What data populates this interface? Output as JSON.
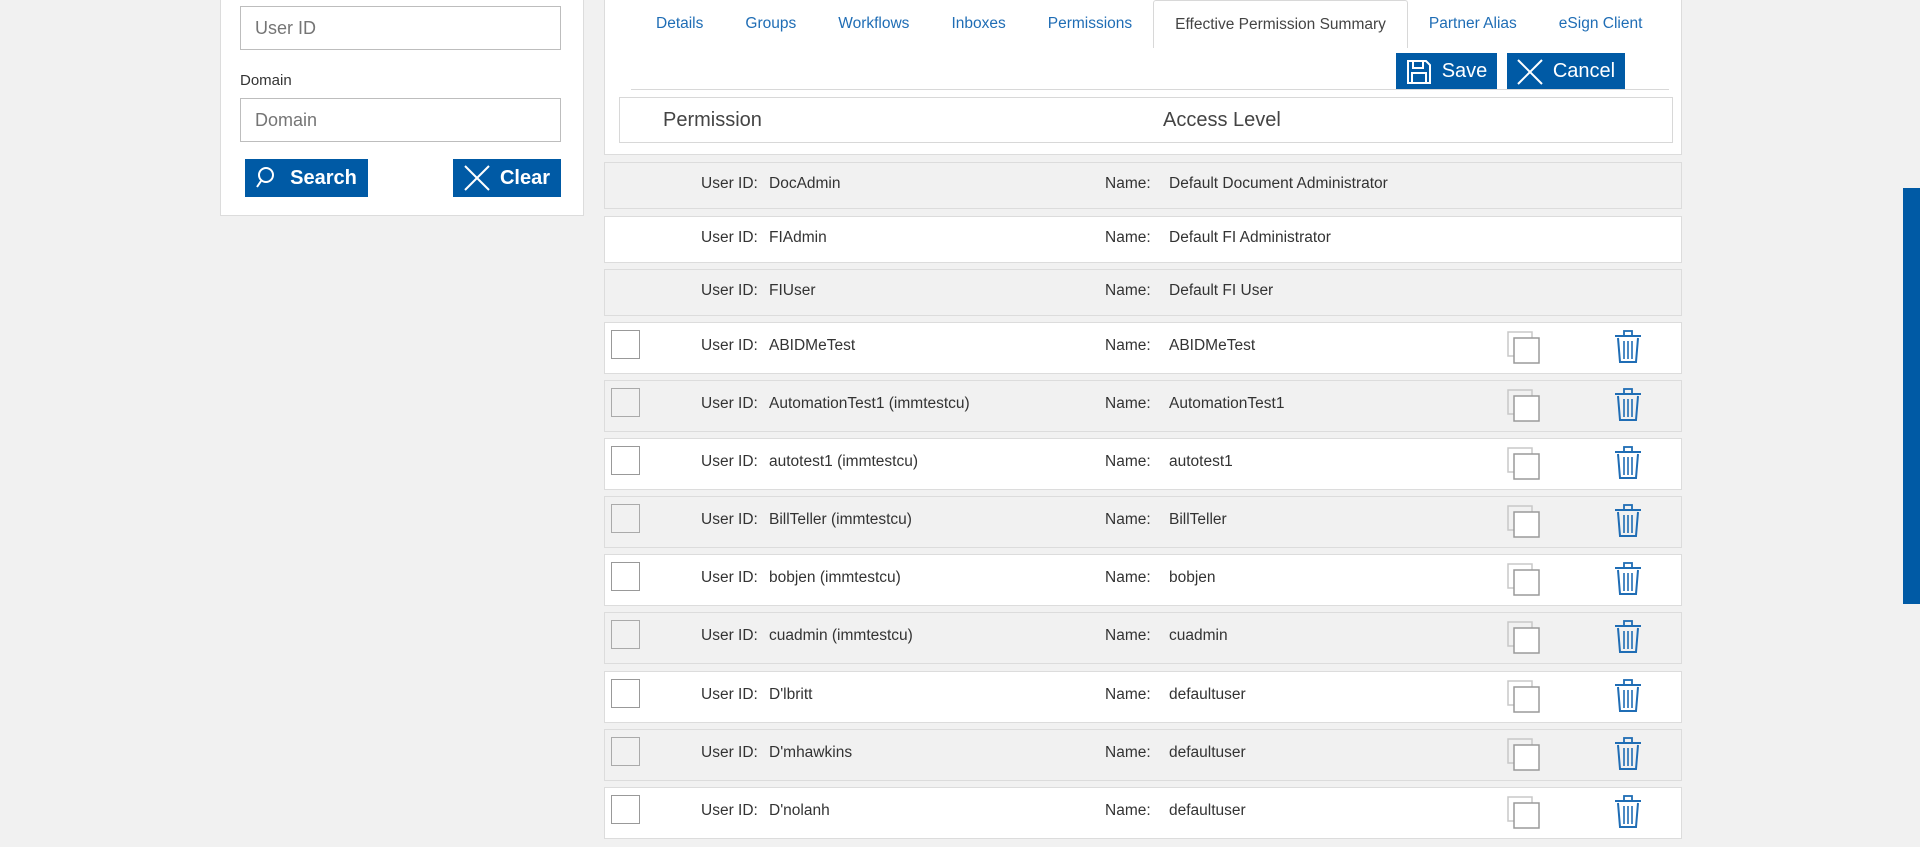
{
  "left_panel": {
    "user_id_placeholder": "User ID",
    "domain_label": "Domain",
    "domain_placeholder": "Domain",
    "search_label": "Search",
    "clear_label": "Clear"
  },
  "tabs": [
    {
      "label": "Details"
    },
    {
      "label": "Groups"
    },
    {
      "label": "Workflows"
    },
    {
      "label": "Inboxes"
    },
    {
      "label": "Permissions"
    },
    {
      "label": "Effective Permission Summary"
    },
    {
      "label": "Partner Alias"
    },
    {
      "label": "eSign Client"
    }
  ],
  "actions": {
    "save_label": "Save",
    "cancel_label": "Cancel"
  },
  "permission_header": {
    "permission": "Permission",
    "access_level": "Access Level"
  },
  "row_labels": {
    "user_id": "User ID:",
    "name": "Name:"
  },
  "users": [
    {
      "user_id": "DocAdmin",
      "name": "Default Document Administrator"
    },
    {
      "user_id": "FIAdmin",
      "name": "Default FI Administrator"
    },
    {
      "user_id": "FIUser",
      "name": "Default FI User"
    },
    {
      "user_id": "ABIDMeTest",
      "name": "ABIDMeTest"
    },
    {
      "user_id": "AutomationTest1 (immtestcu)",
      "name": "AutomationTest1"
    },
    {
      "user_id": "autotest1 (immtestcu)",
      "name": "autotest1"
    },
    {
      "user_id": "BillTeller (immtestcu)",
      "name": "BillTeller"
    },
    {
      "user_id": "bobjen (immtestcu)",
      "name": "bobjen"
    },
    {
      "user_id": "cuadmin (immtestcu)",
      "name": "cuadmin"
    },
    {
      "user_id": "D'lbritt",
      "name": "defaultuser"
    },
    {
      "user_id": "D'mhawkins",
      "name": "defaultuser"
    },
    {
      "user_id": "D'nolanh",
      "name": "defaultuser"
    }
  ],
  "colors": {
    "accent": "#005aa5",
    "link": "#1f6db5",
    "background": "#f1f1f1"
  }
}
